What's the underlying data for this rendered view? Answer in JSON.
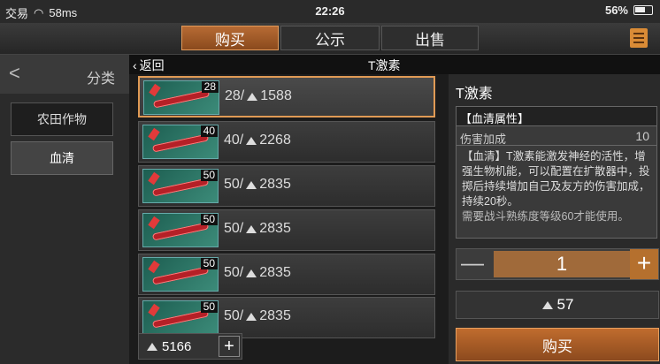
{
  "status": {
    "carrier": "交易",
    "signal": "58ms",
    "time": "22:26",
    "battery": "56%"
  },
  "tabs": [
    {
      "label": "购买",
      "active": true
    },
    {
      "label": "公示",
      "active": false
    },
    {
      "label": "出售",
      "active": false
    }
  ],
  "sidebar": {
    "back_glyph": "<",
    "title": "分类",
    "categories": [
      {
        "label": "农田作物"
      },
      {
        "label": "血清"
      }
    ]
  },
  "list_header": {
    "back_label": "返回",
    "title": "T激素"
  },
  "items": [
    {
      "qty": "28",
      "count": "28/",
      "price": "1588"
    },
    {
      "qty": "40",
      "count": "40/",
      "price": "2268"
    },
    {
      "qty": "50",
      "count": "50/",
      "price": "2835"
    },
    {
      "qty": "50",
      "count": "50/",
      "price": "2835"
    },
    {
      "qty": "50",
      "count": "50/",
      "price": "2835"
    },
    {
      "qty": "50",
      "count": "50/",
      "price": "2835"
    }
  ],
  "wallet": {
    "balance": "5166",
    "plus": "+"
  },
  "detail": {
    "title": "T激素",
    "attr_header": "【血清属性】",
    "attr_name": "伤害加成",
    "attr_value": "10",
    "description": "【血清】T激素能激发神经的活性，增强生物机能，可以配置在扩散器中，投掷后持续增加自己及友方的伤害加成，持续20秒。",
    "requirement": "需要战斗熟练度等级60才能使用。",
    "quantity": "1",
    "minus": "—",
    "plus": "+",
    "total": "57",
    "buy_label": "购买"
  },
  "colors": {
    "accent": "#b5702e",
    "selected_border": "#e09a55",
    "thumb_bg": "#2f7566"
  }
}
